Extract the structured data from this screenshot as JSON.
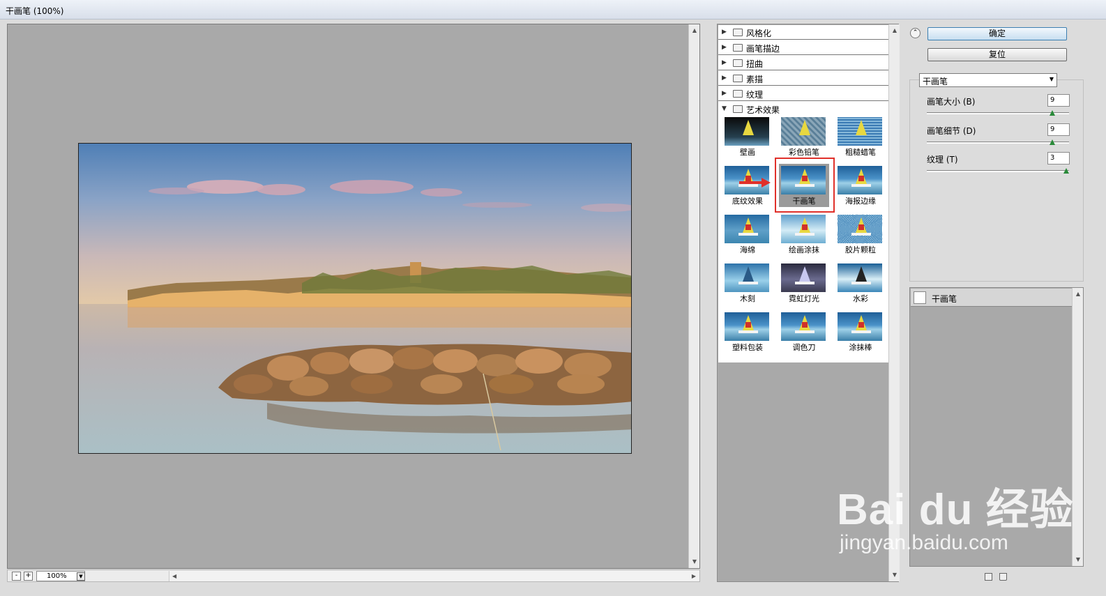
{
  "window": {
    "title": "干画笔 (100%)"
  },
  "preview": {
    "zoom": "100%",
    "zoom_minus": "-",
    "zoom_plus": "+"
  },
  "filters": {
    "categories": [
      {
        "label": "风格化",
        "expanded": false
      },
      {
        "label": "画笔描边",
        "expanded": false
      },
      {
        "label": "扭曲",
        "expanded": false
      },
      {
        "label": "素描",
        "expanded": false
      },
      {
        "label": "纹理",
        "expanded": false
      },
      {
        "label": "艺术效果",
        "expanded": true
      }
    ],
    "thumbnails": [
      {
        "label": "壁画"
      },
      {
        "label": "彩色铅笔"
      },
      {
        "label": "粗糙蜡笔"
      },
      {
        "label": "底纹效果"
      },
      {
        "label": "干画笔"
      },
      {
        "label": "海报边缘"
      },
      {
        "label": "海绵"
      },
      {
        "label": "绘画涂抹"
      },
      {
        "label": "胶片颗粒"
      },
      {
        "label": "木刻"
      },
      {
        "label": "霓虹灯光"
      },
      {
        "label": "水彩"
      },
      {
        "label": "塑料包装"
      },
      {
        "label": "调色刀"
      },
      {
        "label": "涂抹棒"
      }
    ],
    "selected": "干画笔"
  },
  "settings": {
    "ok_label": "确定",
    "reset_label": "复位",
    "filter_select": "干画笔",
    "params": [
      {
        "label": "画笔大小 (B)",
        "value": "9",
        "fraction": 0.9
      },
      {
        "label": "画笔细节 (D)",
        "value": "9",
        "fraction": 0.9
      },
      {
        "label": "纹理 (T)",
        "value": "3",
        "fraction": 1.0
      }
    ]
  },
  "layers": {
    "items": [
      {
        "label": "干画笔"
      }
    ]
  },
  "watermark": {
    "brand": "Bai du 经验",
    "url": "jingyan.baidu.com"
  },
  "colors": {
    "selection_outline": "#e0302a",
    "primary_button": "#3c7fb1"
  }
}
